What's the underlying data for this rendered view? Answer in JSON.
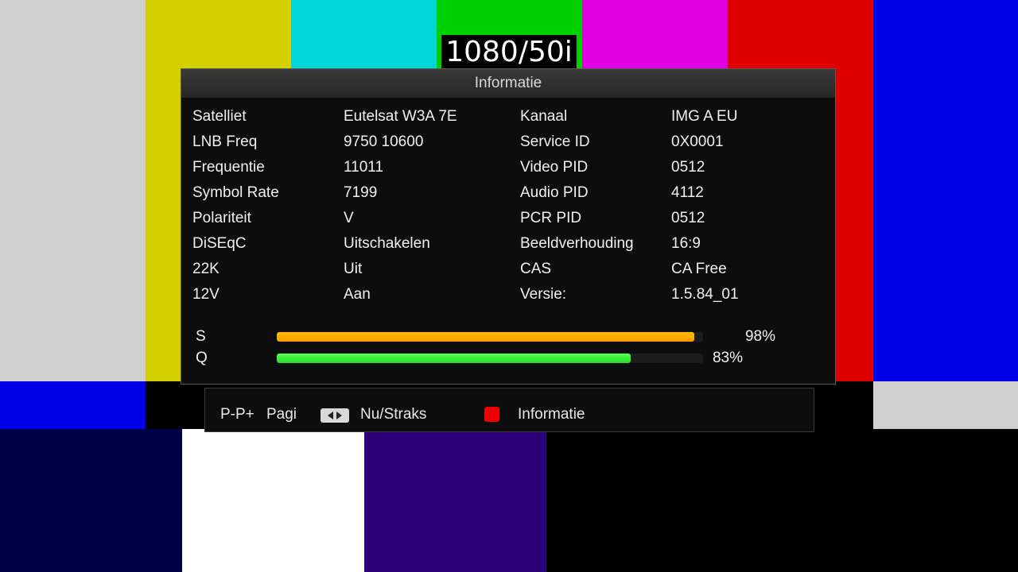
{
  "test_pattern": {
    "resolution": "1080/50i",
    "colors": [
      "#d0d0d0",
      "#d4d000",
      "#00d8d8",
      "#00d000",
      "#e000e0",
      "#e00000",
      "#0000e8",
      "#000046",
      "#ffffff",
      "#2c0078"
    ]
  },
  "panel": {
    "title": "Informatie",
    "left_rows": [
      {
        "label": "Satelliet",
        "value": "Eutelsat W3A 7E"
      },
      {
        "label": "LNB Freq",
        "value": "9750 10600"
      },
      {
        "label": "Frequentie",
        "value": "11011"
      },
      {
        "label": "Symbol Rate",
        "value": "7199"
      },
      {
        "label": "Polariteit",
        "value": "V"
      },
      {
        "label": "DiSEqC",
        "value": "Uitschakelen"
      },
      {
        "label": "22K",
        "value": "Uit"
      },
      {
        "label": "12V",
        "value": "Aan"
      }
    ],
    "right_rows": [
      {
        "label": "Kanaal",
        "value": "IMG A EU"
      },
      {
        "label": "Service ID",
        "value": "0X0001"
      },
      {
        "label": "Video PID",
        "value": "0512"
      },
      {
        "label": "Audio PID",
        "value": "4112"
      },
      {
        "label": "PCR PID",
        "value": "0512"
      },
      {
        "label": "Beeldverhouding",
        "value": "16:9"
      },
      {
        "label": "CAS",
        "value": "CA Free"
      },
      {
        "label": "Versie:",
        "value": "1.5.84_01"
      }
    ],
    "signal": {
      "strength_label": "S",
      "strength_percent": "98%",
      "strength_fraction": 0.98,
      "strength_color": "#ffc000",
      "quality_label": "Q",
      "quality_percent": "83%",
      "quality_fraction": 0.83,
      "quality_color": "#22dd22"
    }
  },
  "footer": {
    "page_keys": "P-P+",
    "page_label": "Pagi",
    "lr_icon": "left-right-arrows-icon",
    "now_next_label": "Nu/Straks",
    "red_icon": "red-key-icon",
    "info_label": "Informatie"
  }
}
